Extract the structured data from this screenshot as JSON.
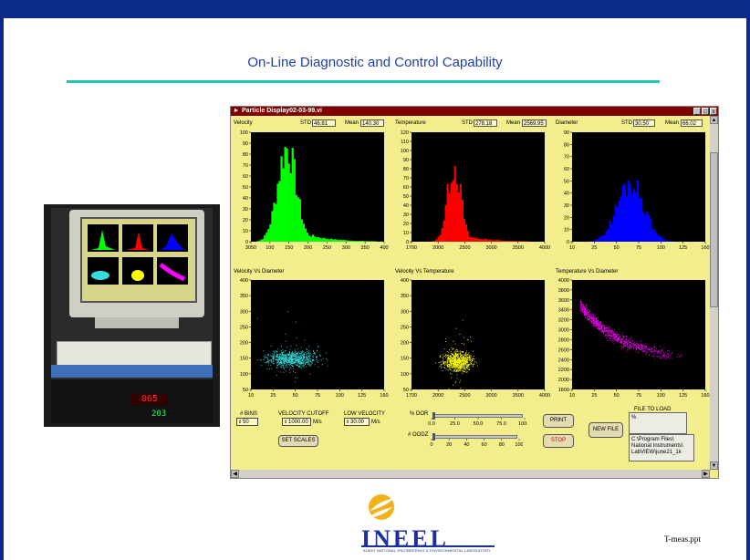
{
  "slide": {
    "title": "On-Line Diagnostic and Control Capability",
    "footer": "T-meas.ppt"
  },
  "photo": {
    "display_red": "065",
    "display_green": "203"
  },
  "window": {
    "title": "Particle Display02-03-99.vi",
    "minimize_label": "_",
    "maximize_label": "□",
    "close_label": "x"
  },
  "histograms": [
    {
      "label": "Velocity",
      "std_label": "STD",
      "std_value": "46.81",
      "mean_label": "Mean",
      "mean_value": "140.30",
      "color": "#00ff00",
      "y_ticks": [
        "100",
        "90",
        "80",
        "70",
        "60",
        "50",
        "40",
        "30",
        "20",
        "10",
        "0"
      ],
      "x_ticks": [
        "3050",
        "100",
        "150",
        "200",
        "250",
        "300",
        "350",
        "400"
      ]
    },
    {
      "label": "Temperature",
      "std_label": "STD",
      "std_value": "278.18",
      "mean_label": "Mean",
      "mean_value": "2569.95",
      "color": "#ff0000",
      "y_ticks": [
        "120",
        "110",
        "100",
        "90",
        "80",
        "70",
        "60",
        "50",
        "40",
        "30",
        "20",
        "10",
        "0"
      ],
      "x_ticks": [
        "1700",
        "2000",
        "2500",
        "3000",
        "3500",
        "4000"
      ]
    },
    {
      "label": "Diameter",
      "std_label": "STD",
      "std_value": "30.50",
      "mean_label": "Mean",
      "mean_value": "66.02",
      "color": "#0000ff",
      "y_ticks": [
        "90",
        "80",
        "70",
        "60",
        "50",
        "40",
        "30",
        "20",
        "10",
        "0"
      ],
      "x_ticks": [
        "10",
        "25",
        "50",
        "75",
        "100",
        "125",
        "160"
      ]
    }
  ],
  "scatters": [
    {
      "label": "Velocity Vs Diameter",
      "color": "#33dddd",
      "y_ticks": [
        "400",
        "350",
        "300",
        "250",
        "200",
        "150",
        "100",
        "50"
      ],
      "x_ticks": [
        "10",
        "25",
        "50",
        "75",
        "100",
        "125",
        "160"
      ]
    },
    {
      "label": "Velocity Vs Temperature",
      "color": "#ffff00",
      "y_ticks": [
        "400",
        "350",
        "300",
        "250",
        "200",
        "150",
        "100",
        "50"
      ],
      "x_ticks": [
        "1700",
        "2000",
        "2500",
        "3000",
        "3500",
        "4000"
      ]
    },
    {
      "label": "Temperature Vs Diameter",
      "color": "#ff00ff",
      "y_ticks": [
        "4000",
        "3800",
        "3600",
        "3400",
        "3200",
        "3000",
        "2800",
        "2600",
        "2400",
        "2200",
        "2000",
        "1800"
      ],
      "x_ticks": [
        "10",
        "25",
        "50",
        "75",
        "100",
        "125",
        "160"
      ]
    }
  ],
  "controls": {
    "bins_label": "# BINS",
    "bins_value": "50",
    "velocity_cutoff_label": "VELOCITY CUTOFF",
    "velocity_cutoff_value": "1000.00",
    "velocity_cutoff_unit": "M/s",
    "low_velocity_label": "LOW VELOCITY",
    "low_velocity_value": "30.00",
    "low_velocity_unit": "M/s",
    "set_scales_label": "SET SCALES",
    "dor_label": "% DOR",
    "dor_ticks": [
      "0.0",
      "25.0",
      "50.0",
      "75.0",
      "100.0"
    ],
    "dor_value": 0,
    "oodz_label": "# OODZ",
    "oodz_ticks": [
      "0",
      "20",
      "40",
      "60",
      "80",
      "100"
    ],
    "oodz_value": 0,
    "print_label": "PRINT",
    "stop_label": "STOP",
    "new_file_label": "NEW FILE",
    "file_to_load_label": "FILE TO LOAD",
    "path_prefix": "%",
    "file_path_lines": [
      "C:\\Program Files\\",
      "National Instruments\\",
      "LabVIEW\\june21_1k"
    ]
  },
  "logo": {
    "text": "INEEL",
    "subtitle": "IDAHO NATIONAL ENGINEERING & ENVIRONMENTAL LABORATORY"
  }
}
